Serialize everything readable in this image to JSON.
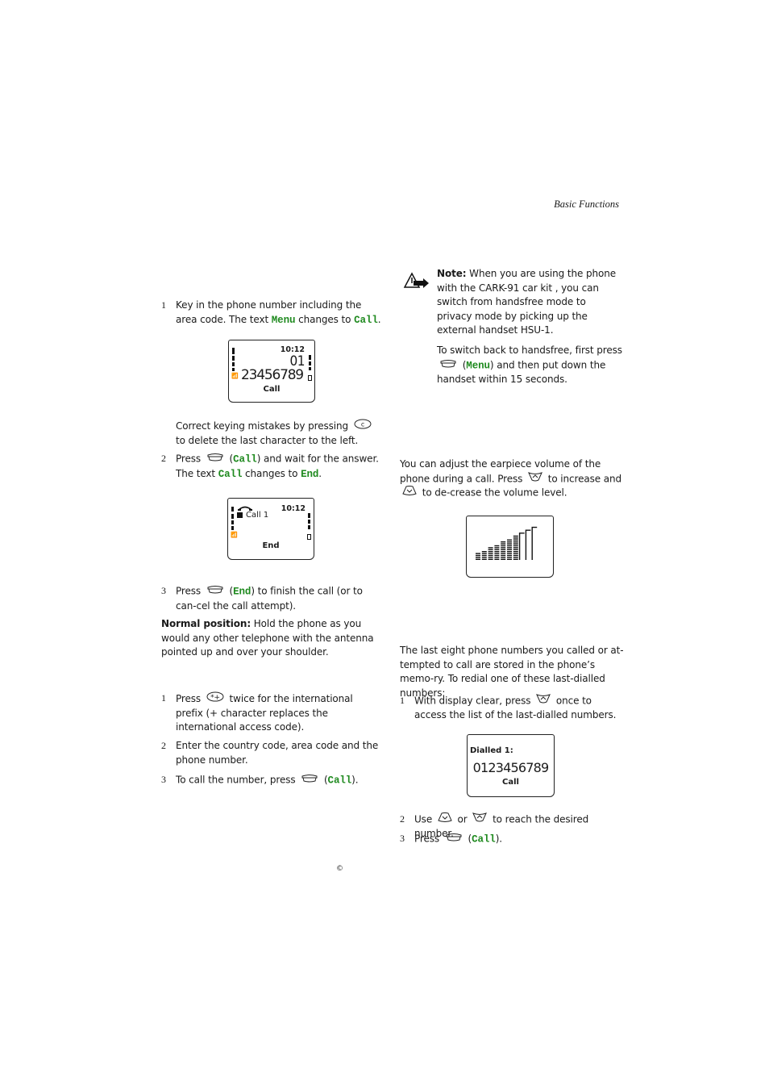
{
  "header": {
    "section_title": "Basic Functions"
  },
  "left_column": {
    "making_call": {
      "step1": {
        "num": "1",
        "text_a": "Key in the phone number including the area code. The text ",
        "code1": "Menu",
        "text_b": " changes to ",
        "code2": "Call",
        "text_c": "."
      },
      "screen1": {
        "time": "10:12",
        "line1": "01",
        "line2": "23456789",
        "softkey": "Call"
      },
      "correct_note": {
        "text_a": "Correct keying mistakes by pressing ",
        "key_icon": "clear-key-icon",
        "text_b": " to delete the last character to the left."
      },
      "step2": {
        "num": "2",
        "text_a": "Press ",
        "key_icon": "selection-key-icon",
        "paren_open": " (",
        "code1": "Call",
        "text_b": ") and wait for the answer. The text ",
        "code2": "Call",
        "text_c": " changes to ",
        "code3": "End",
        "text_d": "."
      },
      "screen2": {
        "time": "10:12",
        "line1": "Call 1",
        "softkey": "End"
      },
      "step3": {
        "num": "3",
        "text_a": "Press ",
        "paren_open": " (",
        "code1": "End",
        "text_b": ") to finish the call (or to can-cel the call attempt)."
      },
      "normal_position": {
        "label": "Normal position:",
        "text": " Hold the phone as you would any other telephone with the antenna pointed up and over your shoulder."
      }
    },
    "international": {
      "step1": {
        "num": "1",
        "text_a": "Press ",
        "key_icon": "star-key-icon",
        "text_b": " twice for the international prefix (+ character replaces the international access code)."
      },
      "step2": {
        "num": "2",
        "text": "Enter the country code, area code and the phone number."
      },
      "step3": {
        "num": "3",
        "text_a": "To call the number, press ",
        "paren_open": " (",
        "code1": "Call",
        "text_b": ")."
      }
    }
  },
  "right_column": {
    "note": {
      "icon": "warning-note-icon",
      "label": "Note:",
      "text": " When you are using the phone with the CARK-91 car kit , you can switch from handsfree mode to privacy mode by picking up the external handset HSU-1.",
      "text2_a": "To switch back to handsfree, first press ",
      "paren_open": " (",
      "code1": "Menu",
      "text2_b": ") and then put down the handset within 15 seconds."
    },
    "volume": {
      "text_a": "You can adjust the earpiece volume of the phone during a call. Press ",
      "text_b": " to increase and ",
      "text_c": " to de-crease the volume level.",
      "screen": {
        "bar_levels": 10,
        "current_level": 10
      }
    },
    "redial": {
      "intro": "The last eight phone numbers you called or at-tempted to call are stored in the phone’s memo-ry. To redial one of these last-dialled numbers:",
      "step1": {
        "num": "1",
        "text_a": "With display clear, press ",
        "text_b": " once to access the list of the last-dialled numbers."
      },
      "screen": {
        "title": "Dialled 1:",
        "number": "0123456789",
        "softkey": "Call"
      },
      "step2": {
        "num": "2",
        "text_a": "Use ",
        "text_b": " or ",
        "text_c": " to reach the desired number."
      },
      "step3": {
        "num": "3",
        "text_a": "Press ",
        "paren_open": " (",
        "code1": "Call",
        "text_b": ")."
      }
    }
  },
  "footer": {
    "copyright": "©"
  },
  "colors": {
    "softkey_code": "#1f8a1f",
    "text": "#1a1a1a"
  }
}
